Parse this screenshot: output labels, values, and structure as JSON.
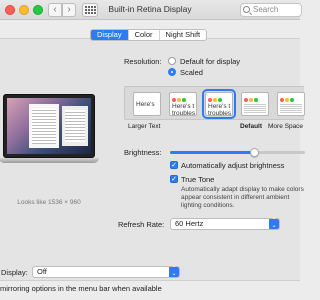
{
  "window": {
    "title": "Built-in Retina Display",
    "search_placeholder": "Search",
    "nav_back": "‹",
    "nav_forward": "›"
  },
  "tabs": [
    {
      "label": "Display",
      "active": true
    },
    {
      "label": "Color",
      "active": false
    },
    {
      "label": "Night Shift",
      "active": false
    }
  ],
  "preview": {
    "caption": "Looks like 1536 × 960"
  },
  "resolution": {
    "label": "Resolution:",
    "options": [
      {
        "label": "Default for display",
        "selected": false
      },
      {
        "label": "Scaled",
        "selected": true
      }
    ]
  },
  "scale_options": {
    "thumbs": [
      {
        "text": "Here's"
      },
      {
        "text": "Here's t\ntroubles"
      },
      {
        "text": "Here's t\ntroubles",
        "selected": true
      },
      {
        "text": "",
        "selected": false
      },
      {
        "text": "",
        "selected": false
      }
    ],
    "label_left": "Larger Text",
    "label_default": "Default",
    "label_right": "More Space"
  },
  "brightness": {
    "label": "Brightness:",
    "value_fraction": 0.62,
    "auto_label": "Automatically adjust brightness",
    "auto_checked": true
  },
  "true_tone": {
    "label": "True Tone",
    "checked": true,
    "description": "Automatically adapt display to make colors appear consistent in different ambient lighting conditions."
  },
  "refresh_rate": {
    "label": "Refresh Rate:",
    "value": "60 Hertz"
  },
  "airplay": {
    "label": "Display:",
    "value": "Off",
    "mirroring_text": "mirroring options in the menu bar when available"
  },
  "colors": {
    "accent": "#2d7cf6",
    "traffic_red": "#fe5f57",
    "traffic_yellow": "#febc2e",
    "traffic_green": "#28c840"
  }
}
